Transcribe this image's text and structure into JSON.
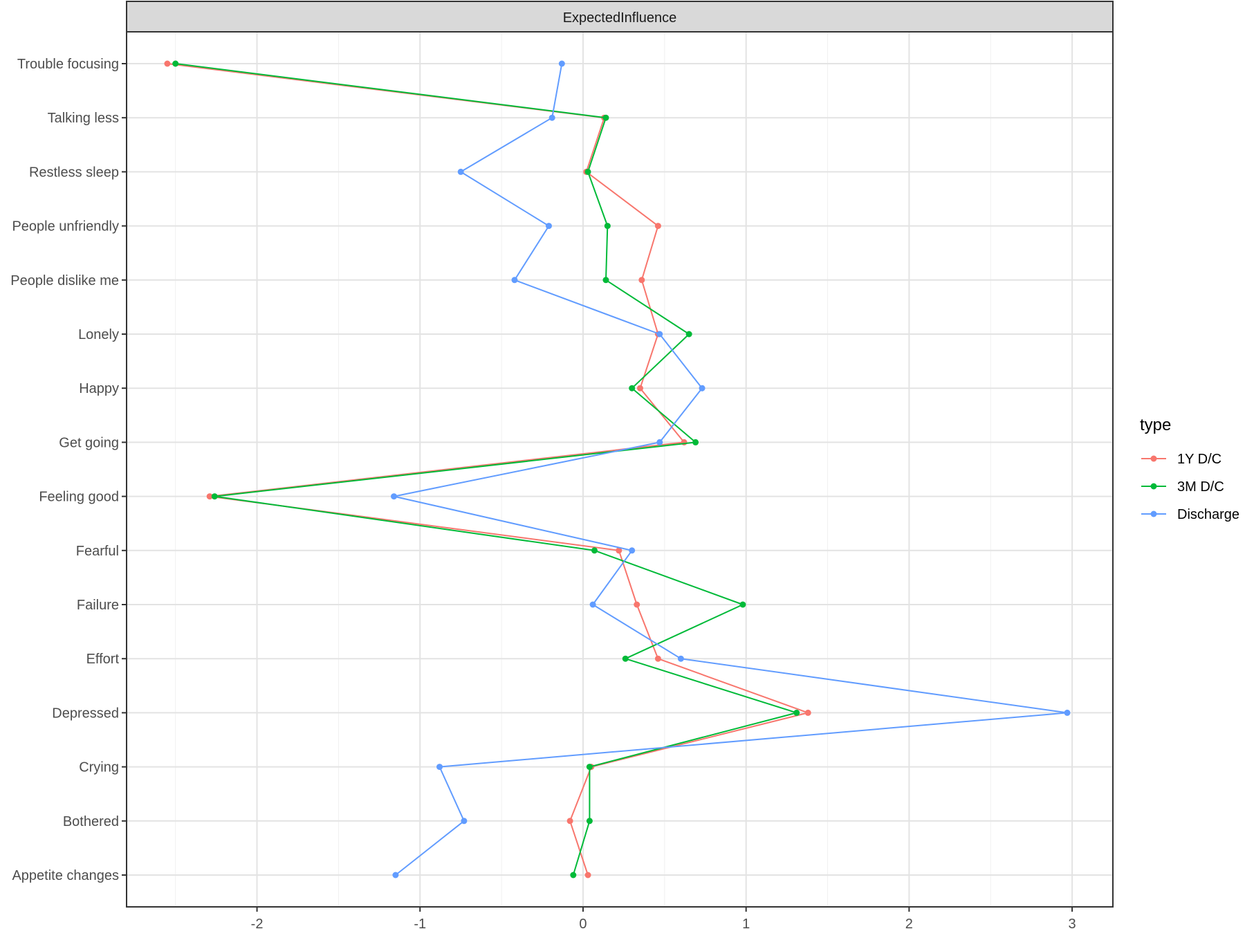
{
  "chart_data": {
    "type": "line",
    "title": "",
    "facet_label": "ExpectedInfluence",
    "xlabel": "",
    "ylabel": "",
    "xlim": [
      -2.8,
      3.25
    ],
    "x_ticks": [
      -2,
      -1,
      0,
      1,
      2,
      3
    ],
    "x_tick_labels": [
      "-2",
      "-1",
      "0",
      "1",
      "2",
      "3"
    ],
    "categories": [
      "Trouble focusing",
      "Talking less",
      "Restless sleep",
      "People unfriendly",
      "People dislike me",
      "Lonely",
      "Happy",
      "Get going",
      "Feeling good",
      "Fearful",
      "Failure",
      "Effort",
      "Depressed",
      "Crying",
      "Bothered",
      "Appetite changes"
    ],
    "series": [
      {
        "name": "1Y D/C",
        "color": "#F8766D",
        "values": [
          -2.55,
          0.13,
          0.02,
          0.46,
          0.36,
          0.46,
          0.35,
          0.62,
          -2.29,
          0.22,
          0.33,
          0.46,
          1.38,
          0.05,
          -0.08,
          0.03
        ]
      },
      {
        "name": "3M D/C",
        "color": "#00BA38",
        "values": [
          -2.5,
          0.14,
          0.03,
          0.15,
          0.14,
          0.65,
          0.3,
          0.69,
          -2.26,
          0.07,
          0.98,
          0.26,
          1.31,
          0.04,
          0.04,
          -0.06
        ]
      },
      {
        "name": "Discharge",
        "color": "#619CFF",
        "values": [
          -0.13,
          -0.19,
          -0.75,
          -0.21,
          -0.42,
          0.47,
          0.73,
          0.47,
          -1.16,
          0.3,
          0.06,
          0.6,
          2.97,
          -0.88,
          -0.73,
          -1.15
        ]
      }
    ],
    "legend": {
      "title": "type",
      "position": "right"
    },
    "grid": true
  }
}
